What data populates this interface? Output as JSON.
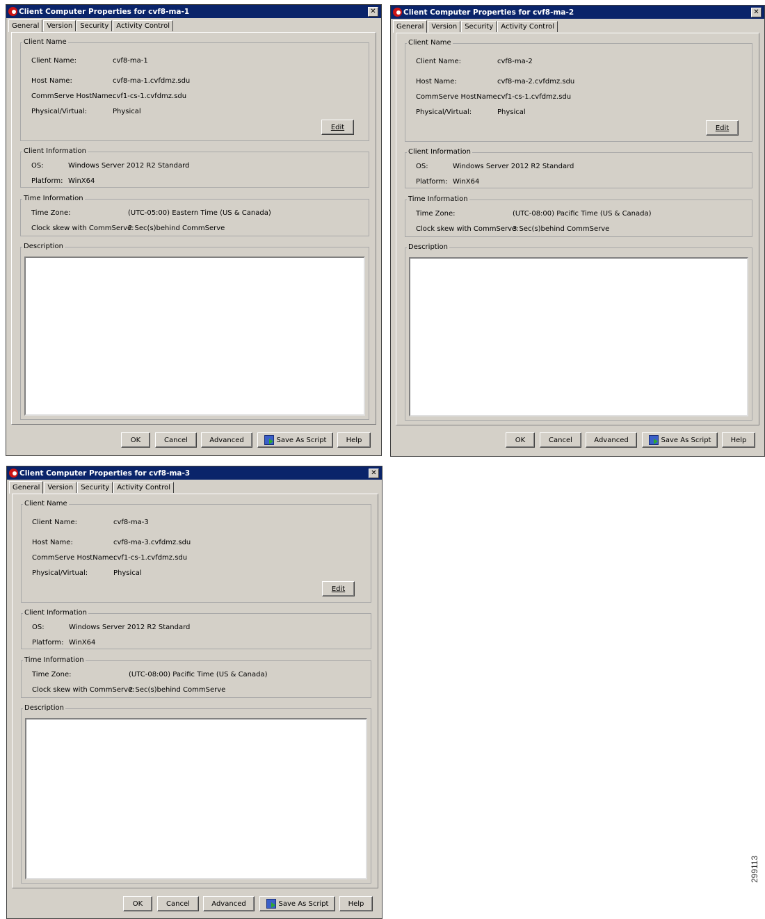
{
  "dialogs": [
    {
      "title": "Client Computer Properties for cvf8-ma-1",
      "tabs": [
        "General",
        "Version",
        "Security",
        "Activity Control"
      ],
      "client_name_legend": "Client Name",
      "client_name_label": "Client Name:",
      "client_name": "cvf8-ma-1",
      "host_name_label": "Host Name:",
      "host_name": "cvf8-ma-1.cvfdmz.sdu",
      "commserve_label": "CommServe HostName:",
      "commserve_host": "cvf1-cs-1.cvfdmz.sdu",
      "phys_label": "Physical/Virtual:",
      "physical_virtual": "Physical",
      "edit_label": "Edit",
      "client_info_legend": "Client Information",
      "os_label": "OS:",
      "os": "Windows Server 2012 R2 Standard",
      "platform_label": "Platform:",
      "platform": "WinX64",
      "time_legend": "Time Information",
      "tz_label": "Time Zone:",
      "time_zone": "(UTC-05:00) Eastern Time (US & Canada)",
      "skew_label": "Clock skew with CommServe:",
      "clock_skew": "2 Sec(s)behind CommServe",
      "description_legend": "Description",
      "buttons": {
        "ok": "OK",
        "cancel": "Cancel",
        "advanced": "Advanced",
        "save_script": "Save As Script",
        "help": "Help"
      }
    },
    {
      "title": "Client Computer Properties for cvf8-ma-2",
      "tabs": [
        "General",
        "Version",
        "Security",
        "Activity Control"
      ],
      "client_name_legend": "Client Name",
      "client_name_label": "Client Name:",
      "client_name": "cvf8-ma-2",
      "host_name_label": "Host Name:",
      "host_name": "cvf8-ma-2.cvfdmz.sdu",
      "commserve_label": "CommServe HostName:",
      "commserve_host": "cvf1-cs-1.cvfdmz.sdu",
      "phys_label": "Physical/Virtual:",
      "physical_virtual": "Physical",
      "edit_label": "Edit",
      "client_info_legend": "Client Information",
      "os_label": "OS:",
      "os": "Windows Server 2012 R2 Standard",
      "platform_label": "Platform:",
      "platform": "WinX64",
      "time_legend": "Time Information",
      "tz_label": "Time Zone:",
      "time_zone": "(UTC-08:00) Pacific Time (US & Canada)",
      "skew_label": "Clock skew with CommServe:",
      "clock_skew": "3 Sec(s)behind CommServe",
      "description_legend": "Description",
      "buttons": {
        "ok": "OK",
        "cancel": "Cancel",
        "advanced": "Advanced",
        "save_script": "Save As Script",
        "help": "Help"
      }
    },
    {
      "title": "Client Computer Properties for cvf8-ma-3",
      "tabs": [
        "General",
        "Version",
        "Security",
        "Activity Control"
      ],
      "client_name_legend": "Client Name",
      "client_name_label": "Client Name:",
      "client_name": "cvf8-ma-3",
      "host_name_label": "Host Name:",
      "host_name": "cvf8-ma-3.cvfdmz.sdu",
      "commserve_label": "CommServe HostName:",
      "commserve_host": "cvf1-cs-1.cvfdmz.sdu",
      "phys_label": "Physical/Virtual:",
      "physical_virtual": "Physical",
      "edit_label": "Edit",
      "client_info_legend": "Client Information",
      "os_label": "OS:",
      "os": "Windows Server 2012 R2 Standard",
      "platform_label": "Platform:",
      "platform": "WinX64",
      "time_legend": "Time Information",
      "tz_label": "Time Zone:",
      "time_zone": "(UTC-08:00) Pacific Time (US & Canada)",
      "skew_label": "Clock skew with CommServe:",
      "clock_skew": "2 Sec(s)behind CommServe",
      "description_legend": "Description",
      "buttons": {
        "ok": "OK",
        "cancel": "Cancel",
        "advanced": "Advanced",
        "save_script": "Save As Script",
        "help": "Help"
      }
    }
  ],
  "figure_id": "299113"
}
